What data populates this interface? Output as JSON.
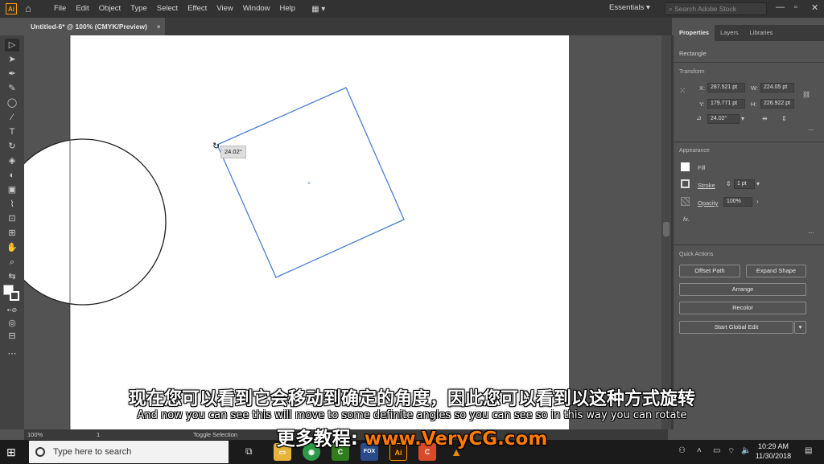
{
  "menubar": {
    "app_badge": "Ai",
    "items": [
      "File",
      "Edit",
      "Object",
      "Type",
      "Select",
      "Effect",
      "View",
      "Window",
      "Help"
    ],
    "workspace": "Essentials",
    "stock_placeholder": "Search Adobe Stock"
  },
  "document": {
    "tab_title": "Untitled-6* @ 100% (CMYK/Preview)",
    "close": "×",
    "rotation_tooltip": "24.02°"
  },
  "status": {
    "zoom": "100%",
    "page": "1",
    "tool": "Toggle Selection"
  },
  "panel": {
    "tabs": [
      "Properties",
      "Layers",
      "Libraries"
    ],
    "selection_type": "Rectangle",
    "transform": {
      "title": "Transform",
      "x_label": "X:",
      "x": "287.521 pt",
      "y_label": "Y:",
      "y": "179.771 pt",
      "w_label": "W:",
      "w": "224.05 pt",
      "h_label": "H:",
      "h": "226.922 pt",
      "angle": "24.02°"
    },
    "appearance": {
      "title": "Appearance",
      "fill_label": "Fill",
      "stroke_label": "Stroke",
      "stroke_weight": "1 pt",
      "opacity_label": "Opacity",
      "opacity": "100%",
      "fx": "fx."
    },
    "quick_actions": {
      "title": "Quick Actions",
      "offset_path": "Offset Path",
      "expand_shape": "Expand Shape",
      "arrange": "Arrange",
      "recolor": "Recolor",
      "global_edit": "Start Global Edit"
    }
  },
  "subtitles": {
    "chinese": "现在您可以看到它会移动到确定的角度，因此您可以看到以这种方式旋转",
    "english": "And now you can see this will move to some definite angles so you can see so in this way you can rotate",
    "brand_prefix": "更多教程:",
    "brand_url": "www.VeryCG.com"
  },
  "taskbar": {
    "search_placeholder": "Type here to search",
    "time": "10:29 AM",
    "date": "11/30/2018"
  },
  "colors": {
    "selection_blue": "#4a7fd0",
    "ai_orange": "#ff9a00",
    "brand_orange": "#ff7a00"
  }
}
